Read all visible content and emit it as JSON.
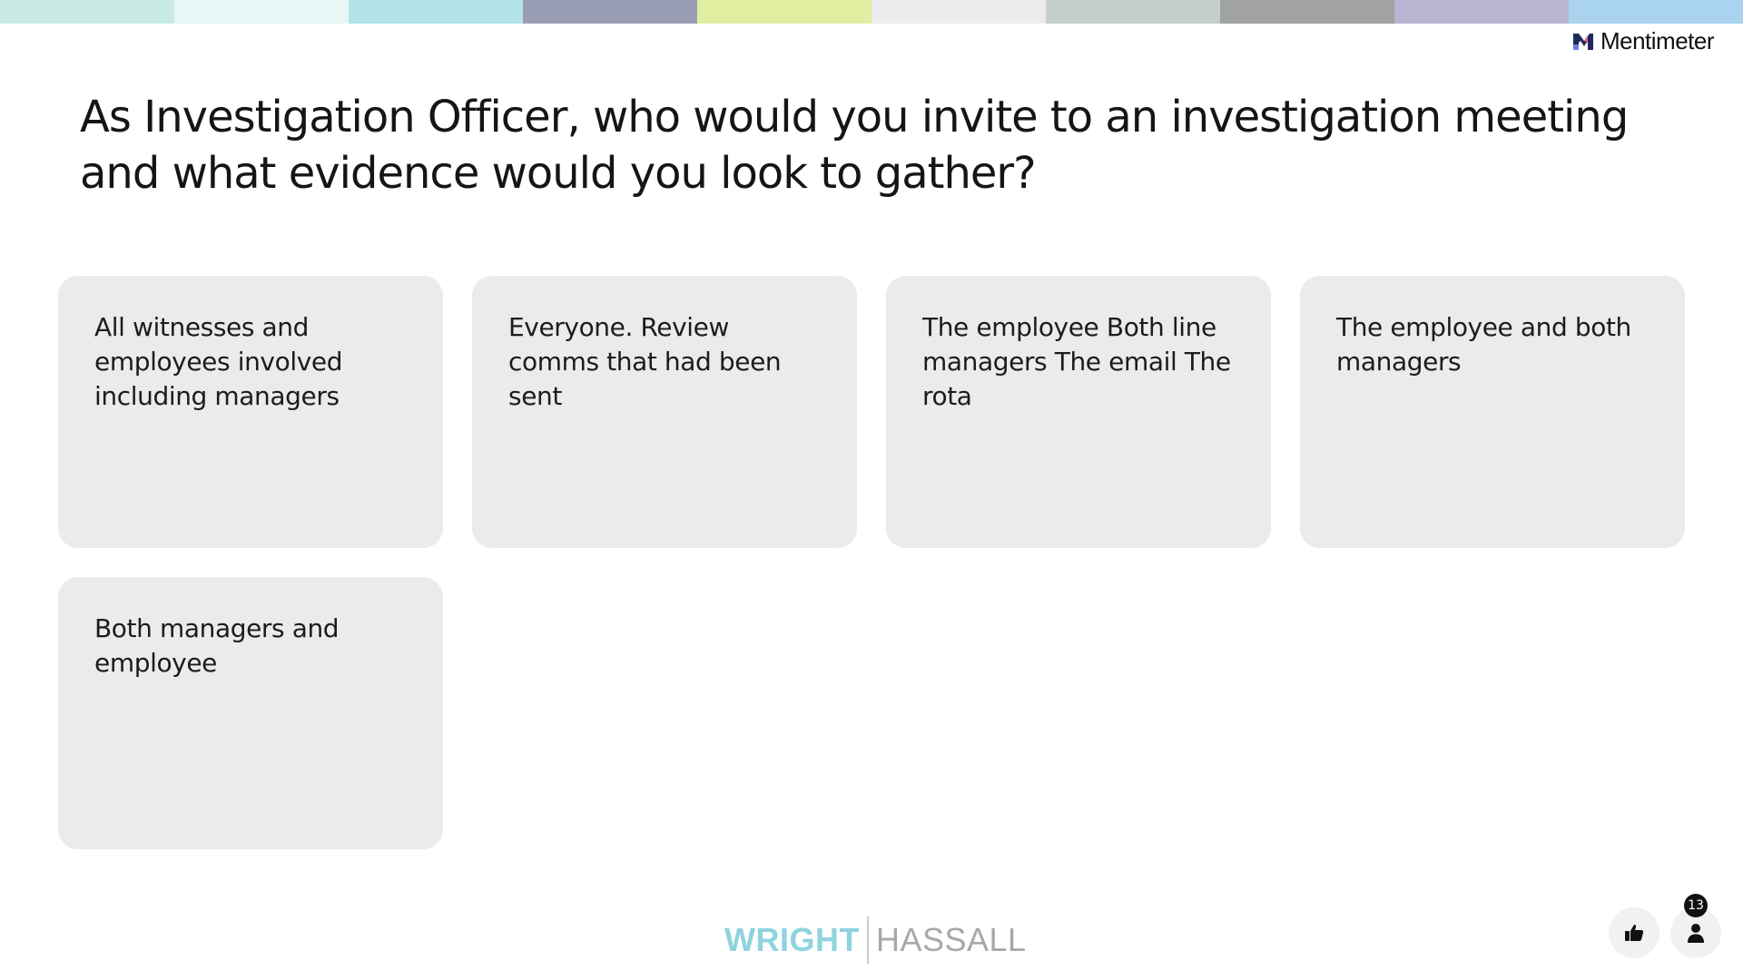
{
  "top_bar": {
    "colors": [
      "#c9ebe6",
      "#e8f6f6",
      "#b3e3e6",
      "#9a9eb5",
      "#dfeea0",
      "#ececec",
      "#c6cfce",
      "#a1a2a3",
      "#b7b5d1",
      "#a9d3ee"
    ]
  },
  "brand": {
    "name": "Mentimeter",
    "icon": "mentimeter-logo-icon"
  },
  "question": {
    "text": "As Investigation Officer, who would you invite to an investigation meeting and what evidence would you look to gather?"
  },
  "responses": [
    {
      "text": "All witnesses and employees involved including managers"
    },
    {
      "text": "Everyone. Review comms that had been sent"
    },
    {
      "text": "The employee Both line managers The email The rota"
    },
    {
      "text": "The employee and both managers"
    },
    {
      "text": "Both managers and employee"
    }
  ],
  "footer": {
    "logo_part1": "WRIGHT",
    "logo_part2": "HASSALL"
  },
  "controls": {
    "like_icon": "thumbs-up-icon",
    "participants_icon": "person-icon",
    "participant_count": "13"
  }
}
